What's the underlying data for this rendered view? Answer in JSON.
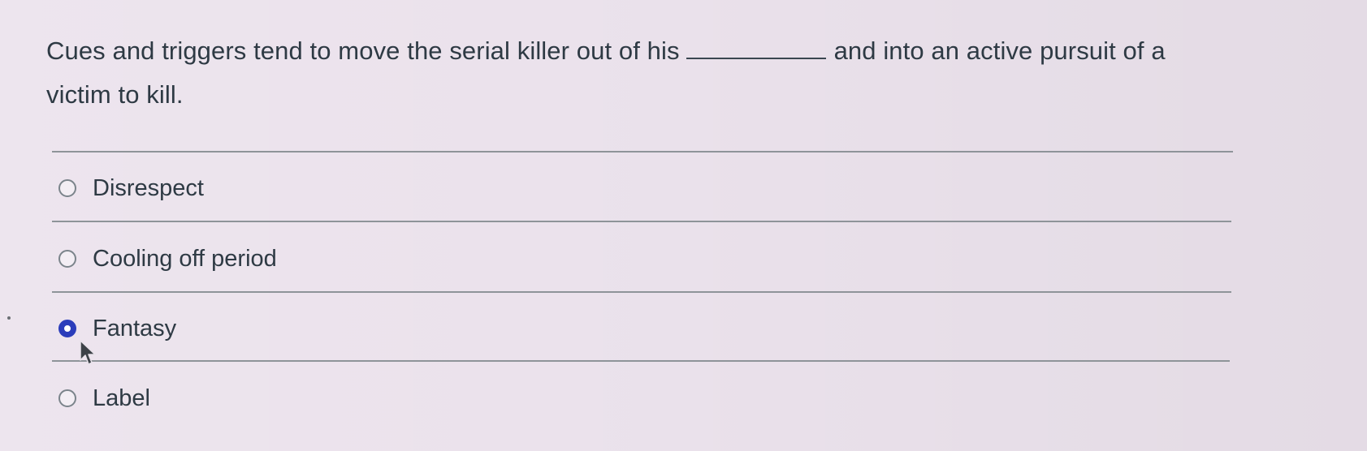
{
  "question": {
    "text_before": "Cues and triggers tend to move the serial killer out of his",
    "text_after": "and into an active pursuit of a victim to kill."
  },
  "answers": [
    {
      "label": "Disrespect",
      "selected": false
    },
    {
      "label": "Cooling off period",
      "selected": false
    },
    {
      "label": "Fantasy",
      "selected": true
    },
    {
      "label": "Label",
      "selected": false
    }
  ],
  "colors": {
    "selected_radio": "#2b3dbb",
    "text": "#2e3a44",
    "background": "#ebe2ec"
  },
  "icons": {
    "pointer": "mouse-pointer-icon"
  }
}
